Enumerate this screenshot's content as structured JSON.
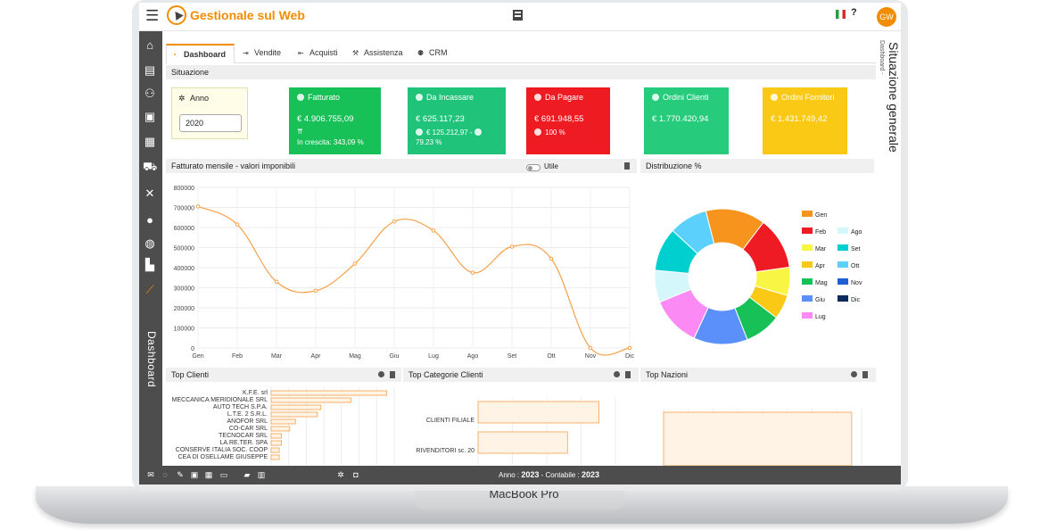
{
  "device": {
    "label": "MacBook Pro"
  },
  "header": {
    "title": "Gestionale sul Web",
    "avatar": "GW",
    "help_mark": "?"
  },
  "sidebar": {
    "vertical_label": "Dashboard",
    "icons": [
      "home-icon",
      "document-icon",
      "people-icon",
      "boxes-icon",
      "calculator-icon",
      "car-icon",
      "tools-icon",
      "person-icon",
      "globe-icon",
      "factory-icon",
      "chart-line-icon"
    ]
  },
  "page": {
    "breadcrumb": "Dashboard -",
    "title": "Situazione generale"
  },
  "tabs": [
    {
      "label": "Dashboard",
      "icon": "dashboard-icon"
    },
    {
      "label": "Vendite",
      "icon": "sign-out-icon"
    },
    {
      "label": "Acquisti",
      "icon": "sign-in-icon"
    },
    {
      "label": "Assistenza",
      "icon": "wrench-icon"
    },
    {
      "label": "CRM",
      "icon": "users-icon"
    }
  ],
  "situazione": {
    "heading": "Situazione",
    "anno_label": "Anno",
    "anno_value": "2020"
  },
  "kpis": [
    {
      "title": "Fatturato",
      "value": "€ 4.906.755,09",
      "sub1": "In crescita: 343,09 %",
      "sub2": "",
      "color": "#18c157"
    },
    {
      "title": "Da Incassare",
      "value": "€ 625.117,23",
      "sub1": "€ 125.212,97 - ",
      "sub2": "79.23 %",
      "color": "#1fc47a"
    },
    {
      "title": "Da Pagare",
      "value": "€ 691.948,55",
      "sub1": "100 %",
      "sub2": "",
      "color": "#ee1b23"
    },
    {
      "title": "Ordini Clienti",
      "value": "€ 1.770.420,94",
      "sub1": "",
      "sub2": "",
      "color": "#26cc7c"
    },
    {
      "title": "Ordini Fornitori",
      "value": "€ 1.431.749,42",
      "sub1": "",
      "sub2": "",
      "color": "#fac915"
    }
  ],
  "line_panel": {
    "title": "Fatturato mensile - valori imponibili",
    "toggle_label": "Utile"
  },
  "pie_panel": {
    "title": "Distribuzione %"
  },
  "chart_data": [
    {
      "type": "line",
      "categories": [
        "Gen",
        "Feb",
        "Mar",
        "Apr",
        "Mag",
        "Giu",
        "Lug",
        "Ago",
        "Set",
        "Ott",
        "Nov",
        "Dic"
      ],
      "series": [
        {
          "values": [
            705000,
            615000,
            330000,
            285000,
            420000,
            630000,
            585000,
            375000,
            505000,
            445000,
            0,
            0
          ]
        }
      ],
      "ylim": [
        0,
        800000
      ],
      "yticks": [
        0,
        100000,
        200000,
        300000,
        400000,
        500000,
        600000,
        700000,
        800000
      ],
      "color": "#f5a14a",
      "grid": true
    },
    {
      "type": "pie",
      "donut": true,
      "labels": [
        "Gen",
        "Feb",
        "Mar",
        "Apr",
        "Mag",
        "Giu",
        "Lug",
        "Ago",
        "Set",
        "Ott",
        "Nov",
        "Dic"
      ],
      "values": [
        14.2,
        12.4,
        6.7,
        5.8,
        8.6,
        12.8,
        11.9,
        7.6,
        10.3,
        9.1,
        0,
        0
      ],
      "colors": [
        "#f7941d",
        "#ee1b23",
        "#f9f545",
        "#fac915",
        "#18c157",
        "#5b8ff9",
        "#fb8af5",
        "#d4f7fc",
        "#00cfcf",
        "#5bd0fc",
        "#1f5fd6",
        "#0b2a5e"
      ],
      "legend_position": "right"
    },
    {
      "type": "bar",
      "orientation": "horizontal",
      "title": "Top Clienti",
      "categories": [
        "K.F.E. srl",
        "MECCANICA MERIDIONALE SRL",
        "AUTO TECH S.P.A.",
        "L.T.E. 2 S.R.L.",
        "ANOFOR SRL",
        "CO-CAR SRL",
        "TECNOCAR SRL",
        "LA.RE.TER. SPA",
        "CONSERVE ITALIA SOC. COOP",
        "CEA DI OSELLAME GIUSEPPE"
      ],
      "values": [
        100,
        69,
        43,
        40,
        21,
        16,
        9,
        9,
        7,
        7
      ]
    },
    {
      "type": "bar",
      "orientation": "horizontal",
      "title": "Top Categorie Clienti",
      "categories": [
        "CLIENTI FILIALE",
        "RIVENDITORI sc. 20"
      ],
      "values": [
        100,
        74
      ]
    },
    {
      "type": "bar",
      "orientation": "horizontal",
      "title": "Top Nazioni",
      "categories": [
        ""
      ],
      "values": [
        100
      ]
    }
  ],
  "statusbar": {
    "anno_label": "Anno :",
    "anno_value": "2023",
    "contabile_label": "- Contabile :",
    "contabile_value": "2023"
  }
}
